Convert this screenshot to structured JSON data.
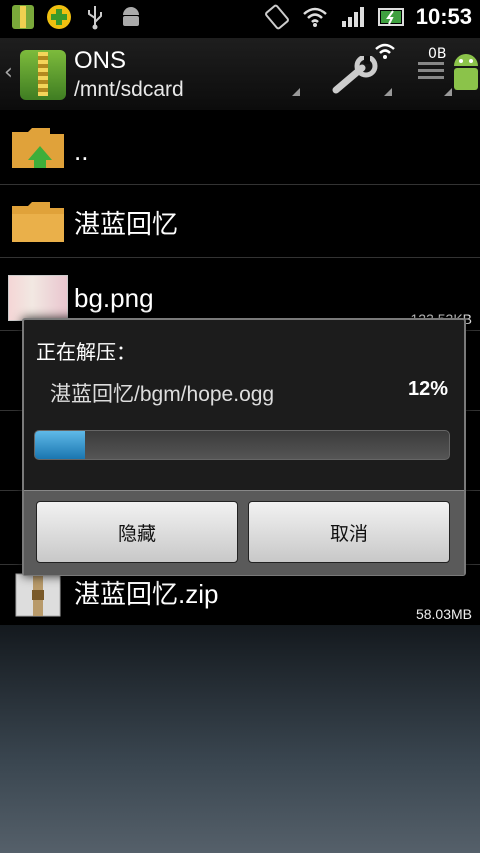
{
  "status_bar": {
    "time": "10:53",
    "icons_left": [
      "notification-icon",
      "plus-icon",
      "usb-icon",
      "android-icon"
    ],
    "icons_right": [
      "rotate-icon",
      "wifi-icon",
      "signal-icon",
      "battery-icon"
    ]
  },
  "header": {
    "title": "ONS",
    "path": "/mnt/sdcard",
    "bytes_label": "0B"
  },
  "files": [
    {
      "name": "..",
      "type": "parent-folder",
      "size": ""
    },
    {
      "name": "湛蓝回忆",
      "type": "folder",
      "size": ""
    },
    {
      "name": "bg.png",
      "type": "image",
      "size": "123.53KB"
    },
    {
      "name": "湛蓝回忆.zip",
      "type": "zip",
      "size": "58.03MB"
    }
  ],
  "dialog": {
    "title": "正在解压：",
    "file": "湛蓝回忆/bgm/hope.ogg",
    "percent_label": "12%",
    "progress": 0.12,
    "hide_label": "隐藏",
    "cancel_label": "取消"
  },
  "colors": {
    "progress_fill": "#2a8fd0",
    "folder": "#e0a23a",
    "accent_green": "#3fae3a"
  }
}
